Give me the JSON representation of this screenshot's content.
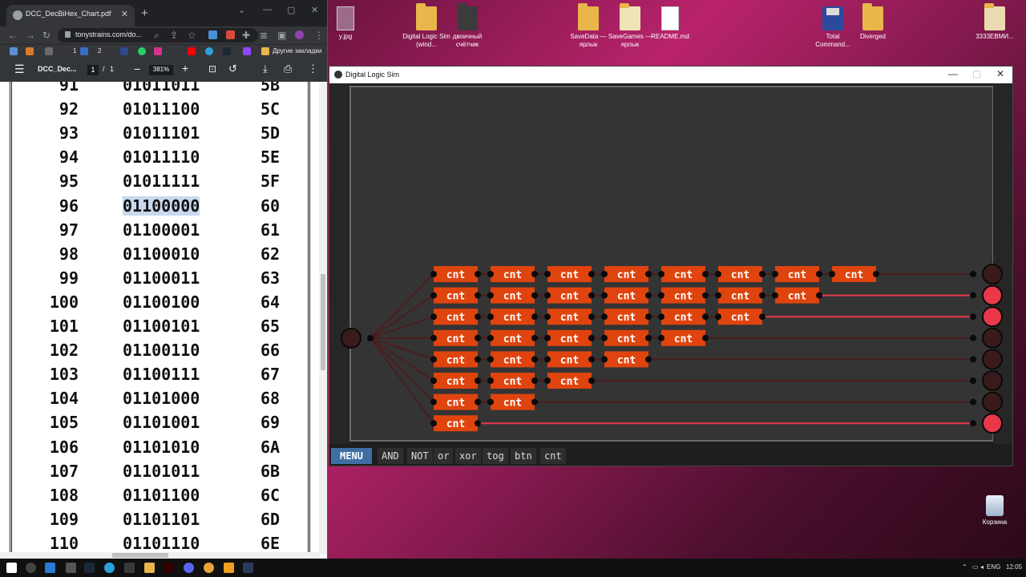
{
  "desktop": {
    "icons": [
      {
        "label": "y.jpg",
        "kind": "image"
      },
      {
        "label": "Digital Logic Sim (wind...",
        "kind": "folder"
      },
      {
        "label": "двоичный счётчик",
        "kind": "folder-dark"
      },
      {
        "label": "SaveData — ярлык",
        "kind": "folder"
      },
      {
        "label": "SaveGames — ярлык",
        "kind": "folder"
      },
      {
        "label": "README.md",
        "kind": "doc"
      },
      {
        "label": "Total Command...",
        "kind": "floppy"
      },
      {
        "label": "Diverged",
        "kind": "folder"
      },
      {
        "label": "3333EBMИ...",
        "kind": "folder"
      },
      {
        "label": "Корзина",
        "kind": "recycle"
      }
    ]
  },
  "browser": {
    "tab_title": "DCC_DecBiHex_Chart.pdf",
    "url": "tonystrains.com/do...",
    "bookmarks_label": "Другие закладки",
    "bm_counts": [
      "1",
      "2"
    ],
    "pdf": {
      "title": "DCC_Dec...",
      "page_current": "1",
      "page_sep": "/",
      "page_total": "1",
      "zoom": "381%",
      "rows": [
        {
          "dec": "91",
          "bin": "01011011",
          "hex": "5B"
        },
        {
          "dec": "92",
          "bin": "01011100",
          "hex": "5C"
        },
        {
          "dec": "93",
          "bin": "01011101",
          "hex": "5D"
        },
        {
          "dec": "94",
          "bin": "01011110",
          "hex": "5E"
        },
        {
          "dec": "95",
          "bin": "01011111",
          "hex": "5F"
        },
        {
          "dec": "96",
          "bin": "01100000",
          "hex": "60",
          "selected": true
        },
        {
          "dec": "97",
          "bin": "01100001",
          "hex": "61"
        },
        {
          "dec": "98",
          "bin": "01100010",
          "hex": "62"
        },
        {
          "dec": "99",
          "bin": "01100011",
          "hex": "63"
        },
        {
          "dec": "100",
          "bin": "01100100",
          "hex": "64"
        },
        {
          "dec": "101",
          "bin": "01100101",
          "hex": "65"
        },
        {
          "dec": "102",
          "bin": "01100110",
          "hex": "66"
        },
        {
          "dec": "103",
          "bin": "01100111",
          "hex": "67"
        },
        {
          "dec": "104",
          "bin": "01101000",
          "hex": "68"
        },
        {
          "dec": "105",
          "bin": "01101001",
          "hex": "69"
        },
        {
          "dec": "106",
          "bin": "01101010",
          "hex": "6A"
        },
        {
          "dec": "107",
          "bin": "01101011",
          "hex": "6B"
        },
        {
          "dec": "108",
          "bin": "01101100",
          "hex": "6C"
        },
        {
          "dec": "109",
          "bin": "01101101",
          "hex": "6D"
        },
        {
          "dec": "110",
          "bin": "01101110",
          "hex": "6E"
        }
      ]
    }
  },
  "sim": {
    "title": "Digital Logic Sim",
    "chip_label": "cnt",
    "column_chip_counts": [
      8,
      7,
      6,
      5,
      4,
      3,
      2,
      1
    ],
    "outputs_on": [
      false,
      true,
      true,
      false,
      false,
      false,
      false,
      true
    ],
    "colors": {
      "chip": "#e0440e",
      "wire_on": "#e8384a",
      "wire_off": "#4a1e1e",
      "pin_on": "#e8384a",
      "pin_off": "#3a1a1a"
    },
    "toolbar": [
      "AND",
      "NOT",
      "or",
      "xor",
      "tog",
      "btn",
      "cnt"
    ],
    "menu_label": "MENU"
  },
  "taskbar": {
    "lang": "ENG",
    "time": "12:05"
  }
}
